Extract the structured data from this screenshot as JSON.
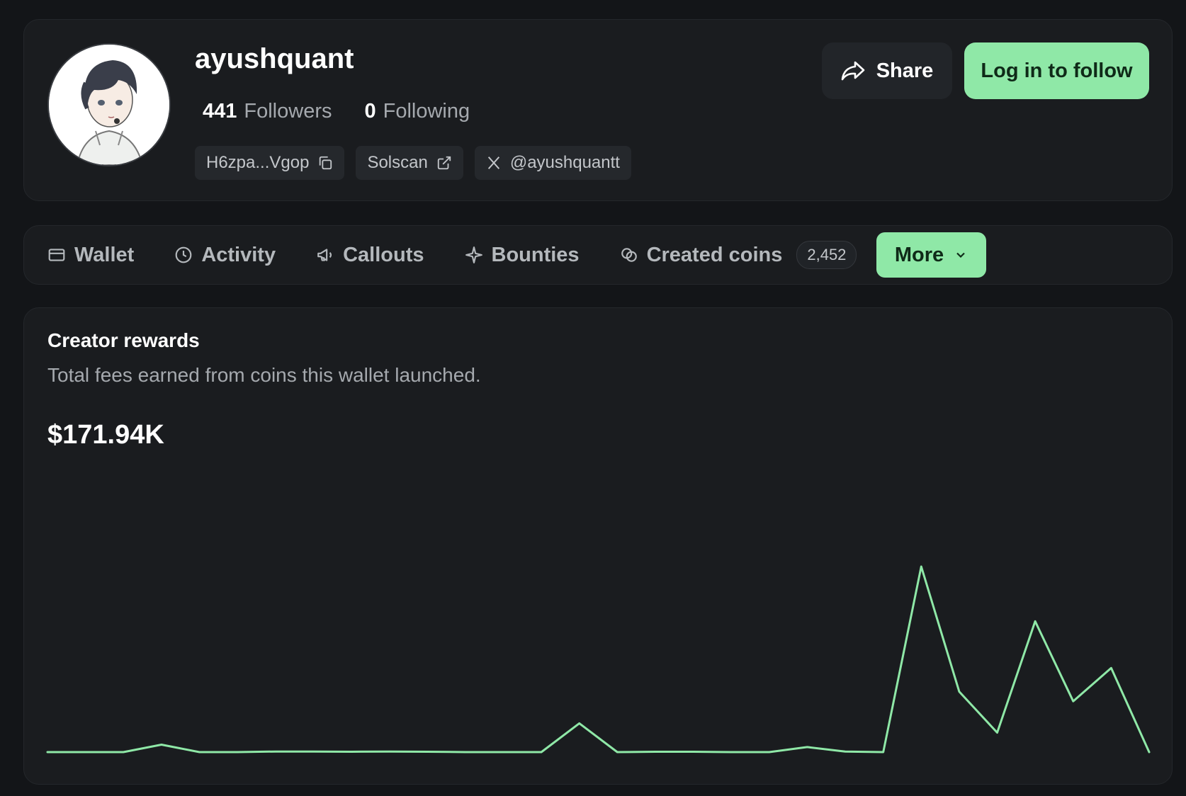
{
  "profile": {
    "username": "ayushquant",
    "followers_count": "441",
    "followers_label": "Followers",
    "following_count": "0",
    "following_label": "Following",
    "wallet_chip": "H6zpa...Vgop",
    "solscan_chip": "Solscan",
    "x_handle": "@ayushquantt",
    "share_label": "Share",
    "follow_label": "Log in to follow"
  },
  "tabs": {
    "items": [
      {
        "label": "Wallet",
        "icon": "wallet-icon"
      },
      {
        "label": "Activity",
        "icon": "clock-icon"
      },
      {
        "label": "Callouts",
        "icon": "megaphone-icon"
      },
      {
        "label": "Bounties",
        "icon": "sparkle-icon"
      },
      {
        "label": "Created coins",
        "icon": "coins-icon",
        "count": "2,452"
      }
    ],
    "more_label": "More"
  },
  "rewards": {
    "title": "Creator rewards",
    "subtitle": "Total fees earned from coins this wallet launched.",
    "total": "$171.94K"
  },
  "colors": {
    "accent": "#8fe8a7",
    "background": "#131518",
    "card": "#1a1c1f"
  },
  "chart_data": {
    "type": "line",
    "title": "",
    "xlabel": "",
    "ylabel": "",
    "grid": false,
    "ylim": [
      0,
      100
    ],
    "x": [
      0,
      1,
      2,
      3,
      4,
      5,
      6,
      7,
      8,
      9,
      10,
      11,
      12,
      13,
      14,
      15,
      16,
      17,
      18,
      19,
      20,
      21,
      22,
      23,
      24,
      25,
      26,
      27,
      28,
      29
    ],
    "series": [
      {
        "color": "#8fe8a7",
        "values": [
          0,
          0,
          0,
          4,
          0,
          0,
          0.3,
          0.3,
          0.2,
          0.3,
          0.2,
          0,
          0,
          0,
          15.5,
          0,
          0.2,
          0.2,
          0,
          0,
          2.7,
          0.3,
          0,
          100,
          32.6,
          10.5,
          70.5,
          27.4,
          45.3,
          0
        ]
      }
    ]
  }
}
